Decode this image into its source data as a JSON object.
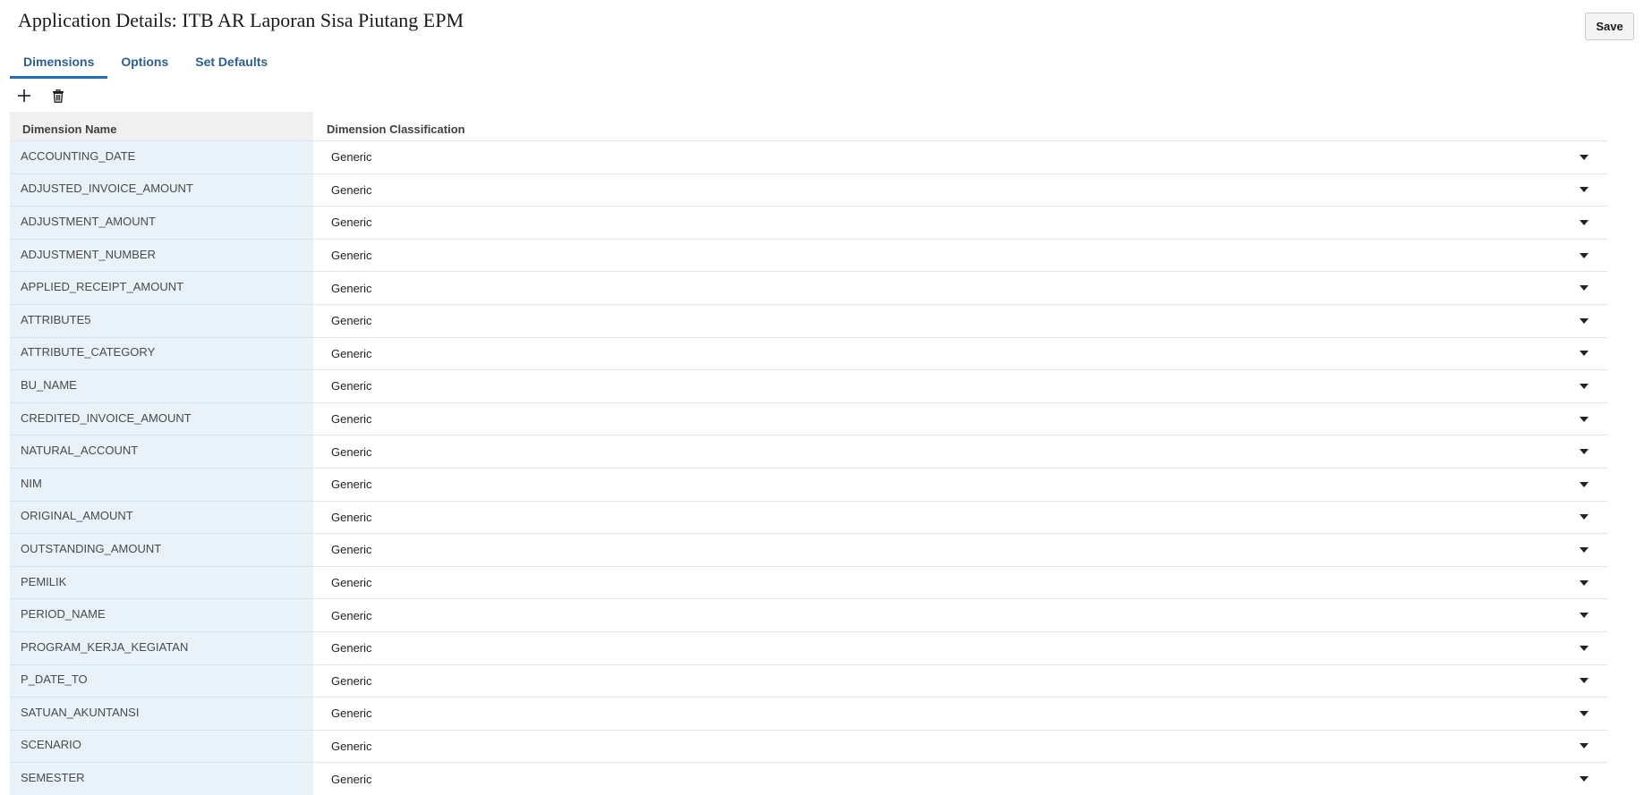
{
  "header": {
    "title": "Application Details: ITB AR Laporan Sisa Piutang EPM",
    "save_label": "Save"
  },
  "tabs": [
    {
      "label": "Dimensions",
      "active": true
    },
    {
      "label": "Options",
      "active": false
    },
    {
      "label": "Set Defaults",
      "active": false
    }
  ],
  "toolbar": {
    "add_icon": "plus-icon",
    "delete_icon": "trash-icon"
  },
  "grid": {
    "columns": [
      "Dimension Name",
      "Dimension Classification"
    ],
    "rows": [
      {
        "name": "ACCOUNTING_DATE",
        "classification": "Generic"
      },
      {
        "name": "ADJUSTED_INVOICE_AMOUNT",
        "classification": "Generic"
      },
      {
        "name": "ADJUSTMENT_AMOUNT",
        "classification": "Generic"
      },
      {
        "name": "ADJUSTMENT_NUMBER",
        "classification": "Generic"
      },
      {
        "name": "APPLIED_RECEIPT_AMOUNT",
        "classification": "Generic"
      },
      {
        "name": "ATTRIBUTE5",
        "classification": "Generic"
      },
      {
        "name": "ATTRIBUTE_CATEGORY",
        "classification": "Generic"
      },
      {
        "name": "BU_NAME",
        "classification": "Generic"
      },
      {
        "name": "CREDITED_INVOICE_AMOUNT",
        "classification": "Generic"
      },
      {
        "name": "NATURAL_ACCOUNT",
        "classification": "Generic"
      },
      {
        "name": "NIM",
        "classification": "Generic"
      },
      {
        "name": "ORIGINAL_AMOUNT",
        "classification": "Generic"
      },
      {
        "name": "OUTSTANDING_AMOUNT",
        "classification": "Generic"
      },
      {
        "name": "PEMILIK",
        "classification": "Generic"
      },
      {
        "name": "PERIOD_NAME",
        "classification": "Generic"
      },
      {
        "name": "PROGRAM_KERJA_KEGIATAN",
        "classification": "Generic"
      },
      {
        "name": "P_DATE_TO",
        "classification": "Generic"
      },
      {
        "name": "SATUAN_AKUNTANSI",
        "classification": "Generic"
      },
      {
        "name": "SCENARIO",
        "classification": "Generic"
      },
      {
        "name": "SEMESTER",
        "classification": "Generic"
      }
    ]
  },
  "colors": {
    "accent": "#1f6fb7",
    "tab_text": "#2d5f8e",
    "name_column_bg": "#e9f2f8",
    "header_bg": "#f0f0f0"
  }
}
